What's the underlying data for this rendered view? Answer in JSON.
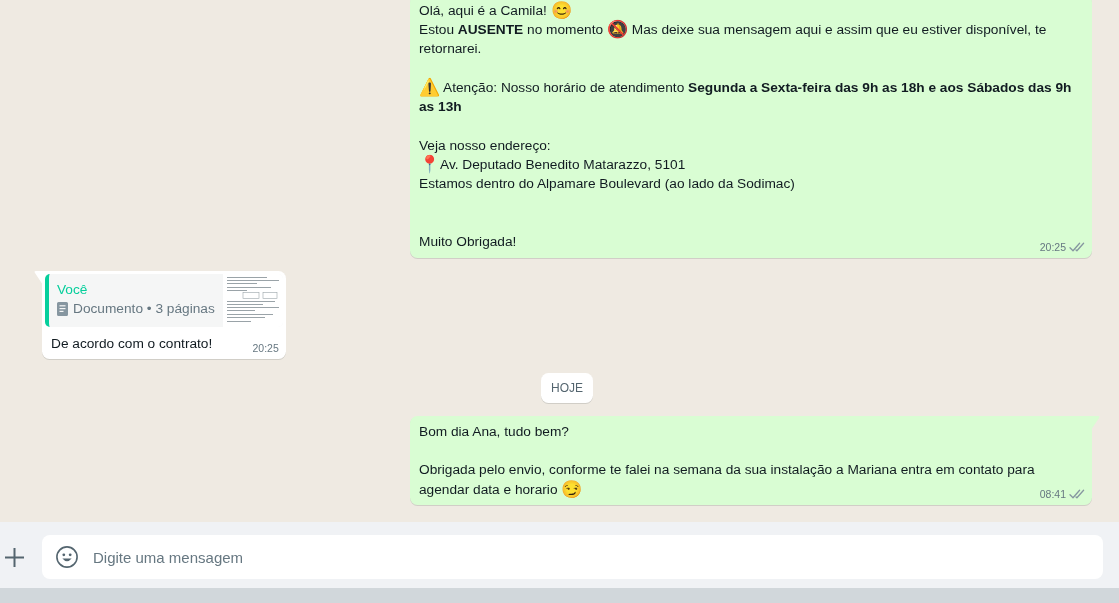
{
  "chat": {
    "items": [
      {
        "kind": "message",
        "outgoing": true,
        "paragraphs": [
          {
            "kind": "text",
            "text": "Olá, aqui é a Camila! 😊"
          },
          {
            "kind": "text",
            "text": "Estou **AUSENTE** no momento 🔕 Mas deixe sua mensagem aqui e assim que eu estiver disponível, te retornarei."
          },
          {
            "kind": "blank"
          },
          {
            "kind": "text",
            "text": "⚠️ Atenção: Nosso horário de atendimento **Segunda a Sexta-feira das 9h as 18h e aos Sábados das 9h as 13h**"
          },
          {
            "kind": "blank"
          },
          {
            "kind": "text",
            "text": "Veja nosso endereço:"
          },
          {
            "kind": "text",
            "text": "📍Av. Deputado Benedito Matarazzo, 5101"
          },
          {
            "kind": "text",
            "text": "Estamos dentro do Alpamare Boulevard (ao lado da Sodimac)"
          },
          {
            "kind": "blank"
          },
          {
            "kind": "blank"
          },
          {
            "kind": "text",
            "text": "Muito Obrigada!"
          }
        ],
        "time": "20:25",
        "read": false
      },
      {
        "kind": "message",
        "outgoing": false,
        "tail": true,
        "quote": {
          "author": "Você",
          "attachment": "Documento • 3 páginas"
        },
        "paragraphs": [
          {
            "kind": "text",
            "text": "De acordo com o contrato!"
          }
        ],
        "time": "20:25"
      },
      {
        "kind": "date",
        "label": "HOJE"
      },
      {
        "kind": "message",
        "outgoing": true,
        "tail": true,
        "paragraphs": [
          {
            "kind": "text",
            "text": "Bom dia Ana, tudo bem?"
          },
          {
            "kind": "blank"
          },
          {
            "kind": "text",
            "text": "Obrigada pelo envio, conforme te falei na semana da sua instalação a Mariana entra em contato para agendar data e horario 😏"
          }
        ],
        "time": "08:41",
        "read": false
      }
    ]
  },
  "composer": {
    "placeholder": "Digite uma mensagem"
  }
}
